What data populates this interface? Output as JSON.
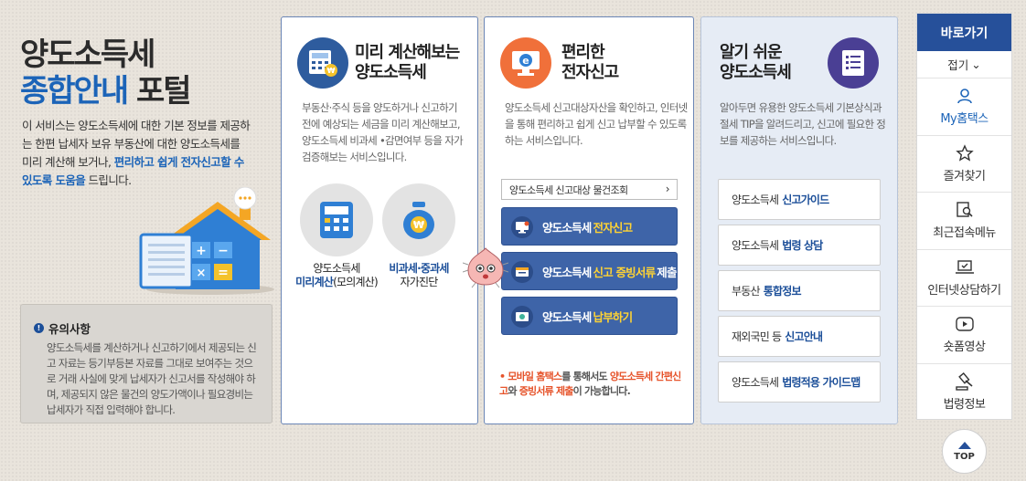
{
  "intro": {
    "title_line1": "양도소득세",
    "title_line2_blue": "종합안내",
    "title_line2_dark": " 포털",
    "desc_plain": "이 서비스는 양도소득세에 대한 기본 정보를 제공하는 한편 납세자 보유 부동산에 대한 양도소득세를 미리 계산해 보거나, ",
    "desc_highlight": "편리하고 쉽게 전자신고할 수 있도록 도움을",
    "desc_end": " 드립니다."
  },
  "notice": {
    "title": "유의사항",
    "text": "양도소득세를 계산하거나 신고하기에서 제공되는 신고 자료는 등기부등본 자료를 그대로 보여주는 것으로 거래 사실에 맞게 납세자가 신고서를 작성해야 하며, 제공되지 않은 물건의 양도가액이나 필요경비는 납세자가 직접 입력해야 합니다."
  },
  "card1": {
    "title_line1": "미리 계산해보는",
    "title_line2": "양도소득세",
    "desc": "부동산·주식 등을 양도하거나 신고하기 전에 예상되는 세금을 미리 계산해보고, 양도소득세 비과세 •감면여부 등을 자가검증해보는 서비스입니다.",
    "calc_label_top": "양도소득세",
    "calc_label_blue": "미리계산",
    "calc_label_end": "(모의계산)",
    "self_label_blue": "비과세·중과세",
    "self_label_bottom": "자가진단"
  },
  "card2": {
    "title_line1": "편리한",
    "title_line2": "전자신고",
    "desc": "양도소득세 신고대상자산을 확인하고, 인터넷을 통해 편리하고 쉽게 신고 납부할 수 있도록 하는 서비스입니다.",
    "lookup_label": "양도소득세 신고대상 물건조회",
    "btn_efile_pre": "양도소득세",
    "btn_efile_hl": "전자신고",
    "btn_docs_pre": "양도소득세",
    "btn_docs_hl": "신고 증빙서류",
    "btn_docs_end": "제출",
    "btn_pay_pre": "양도소득세",
    "btn_pay_hl": "납부하기",
    "mobile_bullet": "•",
    "mobile_hl1": "모바일 홈택스",
    "mobile_mid1": "를 통해서도",
    "mobile_hl2": "양도소득세 간편신고",
    "mobile_mid2": "와",
    "mobile_hl3": "증빙서류 제출",
    "mobile_end": "이 가능합니다."
  },
  "card3": {
    "title_line1": "알기 쉬운",
    "title_line2": "양도소득세",
    "desc": "알아두면 유용한 양도소득세 기본상식과 절세 TIP을 알려드리고, 신고에 필요한 정보를 제공하는 서비스입니다.",
    "guides": [
      {
        "pre": "양도소득세",
        "hl": "신고가이드"
      },
      {
        "pre": "양도소득세",
        "hl": "법령 상담"
      },
      {
        "pre": "부동산",
        "hl": "통합정보"
      },
      {
        "pre": "재외국민 등",
        "hl": "신고안내"
      },
      {
        "pre": "양도소득세",
        "hl": "법령적용 가이드맵"
      }
    ]
  },
  "quicknav": {
    "title": "바로가기",
    "fold": "접기",
    "items": [
      "My홈택스",
      "즐겨찾기",
      "최근접속메뉴",
      "인터넷상담하기",
      "숏폼영상",
      "법령정보"
    ],
    "top": "TOP"
  },
  "colors": {
    "brand_blue": "#26509a",
    "accent_blue": "#1c64b8",
    "button_blue": "#3e64a8",
    "highlight_yellow": "#ffd334",
    "highlight_orange": "#e6532a"
  }
}
